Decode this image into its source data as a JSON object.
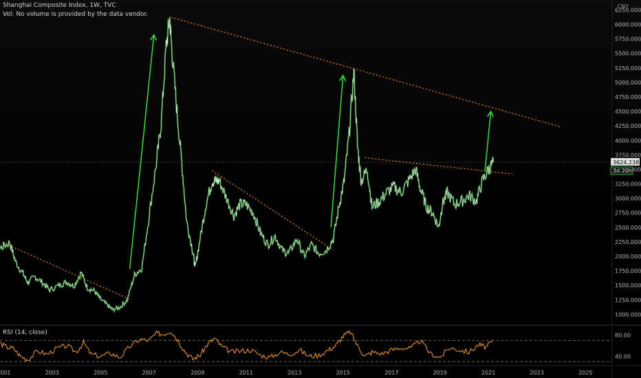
{
  "header": {
    "title": "Shanghai Composite Index, 1W, TVC",
    "vol_note": "Vol: No volume is provided by the data vendor.",
    "currency": "CNY"
  },
  "price_label": {
    "value": "3624.238",
    "countdown": "3d 20h"
  },
  "rsi_header": "RSI (14, close)",
  "colors": {
    "background": "#000000",
    "price": "#2e7d32",
    "price_hi": "#d7f5d3",
    "trend": "#ff8a1c",
    "arrow": "#3ad43a",
    "rsi": "#ff9f2e",
    "axis_text": "#b2b5be",
    "grid": "#2a2a2a"
  },
  "chart_data": [
    {
      "type": "line",
      "title": "Shanghai Composite Index, 1W, TVC",
      "ylim": [
        850,
        6350
      ],
      "y_ticks": [
        "1000.000",
        "1250.000",
        "1500.000",
        "1750.000",
        "2000.000",
        "2250.000",
        "2500.000",
        "2750.000",
        "3000.000",
        "3250.000",
        "3500.000",
        "3750.000",
        "4000.000",
        "4250.000",
        "4500.000",
        "4750.000",
        "5000.000",
        "5250.000",
        "5500.000",
        "5750.000",
        "6000.000",
        "6250.000"
      ],
      "x_ticks": [
        "2001",
        "2003",
        "2005",
        "2007",
        "2009",
        "2011",
        "2013",
        "2015",
        "2017",
        "2019",
        "2021",
        "2023",
        "2025"
      ],
      "series": [
        {
          "x": [
            2000.0,
            2000.3,
            2000.6,
            2000.9,
            2001.25,
            2001.5,
            2001.8,
            2002.0,
            2002.3,
            2002.6,
            2002.9,
            2003.3,
            2003.6,
            2003.9,
            2004.2,
            2004.45,
            2004.75,
            2005.0,
            2005.3,
            2005.5,
            2005.8,
            2006.1,
            2006.4,
            2006.7,
            2007.0,
            2007.3,
            2007.5,
            2007.7,
            2007.85,
            2007.95,
            2008.15,
            2008.35,
            2008.55,
            2008.8,
            2008.9,
            2009.1,
            2009.35,
            2009.6,
            2009.75,
            2009.9,
            2010.2,
            2010.5,
            2010.75,
            2011.0,
            2011.3,
            2011.6,
            2011.9,
            2012.2,
            2012.5,
            2012.75,
            2013.1,
            2013.4,
            2013.7,
            2014.0,
            2014.3,
            2014.6,
            2014.85,
            2015.05,
            2015.25,
            2015.45,
            2015.6,
            2015.75,
            2016.0,
            2016.2,
            2016.5,
            2016.8,
            2017.1,
            2017.4,
            2017.7,
            2018.0,
            2018.2,
            2018.45,
            2018.7,
            2018.95,
            2019.1,
            2019.3,
            2019.6,
            2019.9,
            2020.2,
            2020.5,
            2020.75,
            2021.0,
            2021.2
          ],
          "y": [
            1800,
            2000,
            2080,
            2150,
            2240,
            1900,
            1700,
            1550,
            1650,
            1550,
            1420,
            1500,
            1560,
            1490,
            1720,
            1460,
            1400,
            1260,
            1150,
            1080,
            1120,
            1250,
            1680,
            1800,
            2700,
            3600,
            4300,
            5600,
            6100,
            5500,
            4500,
            3600,
            2600,
            2100,
            1800,
            2300,
            2900,
            3300,
            3300,
            3300,
            3000,
            2700,
            2900,
            2900,
            2750,
            2400,
            2200,
            2350,
            2100,
            2050,
            2300,
            2000,
            2200,
            2050,
            2100,
            2300,
            2900,
            3300,
            4100,
            5180,
            3900,
            3300,
            3500,
            2850,
            2950,
            3100,
            3200,
            3100,
            3300,
            3500,
            3150,
            2850,
            2750,
            2500,
            2900,
            3100,
            2900,
            2950,
            3050,
            2950,
            3300,
            3500,
            3620
          ],
          "current": 3624.238
        }
      ],
      "trendlines": [
        {
          "from": [
            2000.95,
            2240
          ],
          "to": [
            2006.2,
            1260
          ]
        },
        {
          "from": [
            2007.9,
            6124
          ],
          "to": [
            2024.0,
            4230
          ]
        },
        {
          "from": [
            2009.6,
            3478
          ],
          "to": [
            2014.6,
            2110
          ]
        },
        {
          "from": [
            2015.9,
            3700
          ],
          "to": [
            2022.0,
            3420
          ]
        }
      ],
      "arrows": [
        {
          "from": [
            2006.2,
            1780
          ],
          "to": [
            2007.2,
            5820
          ]
        },
        {
          "from": [
            2014.5,
            2500
          ],
          "to": [
            2015.0,
            5120
          ]
        },
        {
          "from": [
            2020.85,
            3460
          ],
          "to": [
            2021.1,
            4500
          ]
        }
      ]
    },
    {
      "type": "line",
      "title": "RSI (14, close)",
      "ylim": [
        25,
        95
      ],
      "y_ticks": [
        "80.00",
        "40.00"
      ],
      "bands": [
        70,
        30
      ],
      "x": [
        2000.0,
        2000.4,
        2000.8,
        2001.1,
        2001.4,
        2001.7,
        2002.0,
        2002.4,
        2002.8,
        2003.2,
        2003.6,
        2004.0,
        2004.3,
        2004.6,
        2005.0,
        2005.4,
        2005.8,
        2006.2,
        2006.6,
        2007.0,
        2007.3,
        2007.6,
        2007.9,
        2008.2,
        2008.5,
        2008.8,
        2009.1,
        2009.4,
        2009.7,
        2010.0,
        2010.4,
        2010.8,
        2011.2,
        2011.6,
        2012.0,
        2012.4,
        2012.8,
        2013.2,
        2013.6,
        2014.0,
        2014.4,
        2014.7,
        2015.0,
        2015.3,
        2015.6,
        2015.9,
        2016.2,
        2016.6,
        2017.0,
        2017.4,
        2017.8,
        2018.2,
        2018.6,
        2019.0,
        2019.4,
        2019.8,
        2020.2,
        2020.6,
        2020.9,
        2021.2
      ],
      "y": [
        45,
        60,
        66,
        58,
        55,
        40,
        34,
        50,
        44,
        55,
        60,
        48,
        66,
        44,
        40,
        46,
        38,
        58,
        72,
        70,
        83,
        82,
        88,
        70,
        48,
        35,
        42,
        62,
        74,
        58,
        48,
        50,
        52,
        42,
        38,
        48,
        44,
        52,
        40,
        42,
        52,
        60,
        78,
        86,
        60,
        40,
        48,
        45,
        52,
        56,
        55,
        70,
        45,
        38,
        56,
        52,
        48,
        62,
        57,
        70
      ]
    }
  ]
}
